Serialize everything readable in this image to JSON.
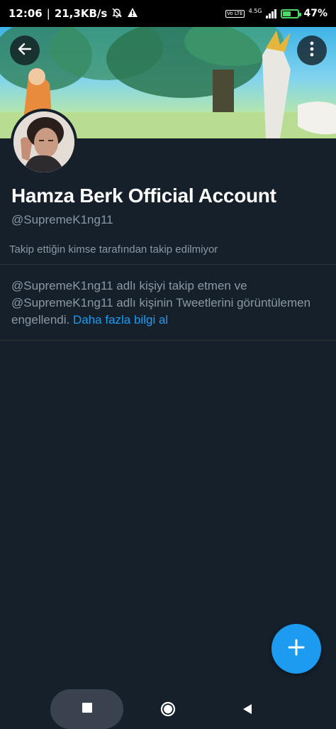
{
  "status_bar": {
    "time": "12:06",
    "separator": "|",
    "net_speed": "21,3KB/s",
    "network_label": "4.5G",
    "volte_label": "Vo LTE",
    "battery_percent": "47%",
    "battery_level": 0.47,
    "icons": [
      "alarm-off-icon",
      "warning-icon",
      "volte-icon",
      "signal-icon",
      "battery-charging-icon"
    ]
  },
  "profile": {
    "display_name": "Hamza Berk Official Account",
    "handle": "@SupremeK1ng11",
    "follow_note": "Takip ettiğin kimse tarafından takip edilmiyor"
  },
  "blocked": {
    "message": "@SupremeK1ng11 adlı kişiyi takip etmen ve @SupremeK1ng11 adlı kişinin Tweetlerini görüntülemen engellendi.",
    "learn_more": "Daha fazla bilgi al"
  },
  "colors": {
    "background": "#15202b",
    "accent": "#1d9bf0",
    "secondary_text": "#8b98a5"
  },
  "icons": {
    "back": "back-arrow-icon",
    "more": "more-vertical-icon",
    "compose": "plus-icon"
  }
}
